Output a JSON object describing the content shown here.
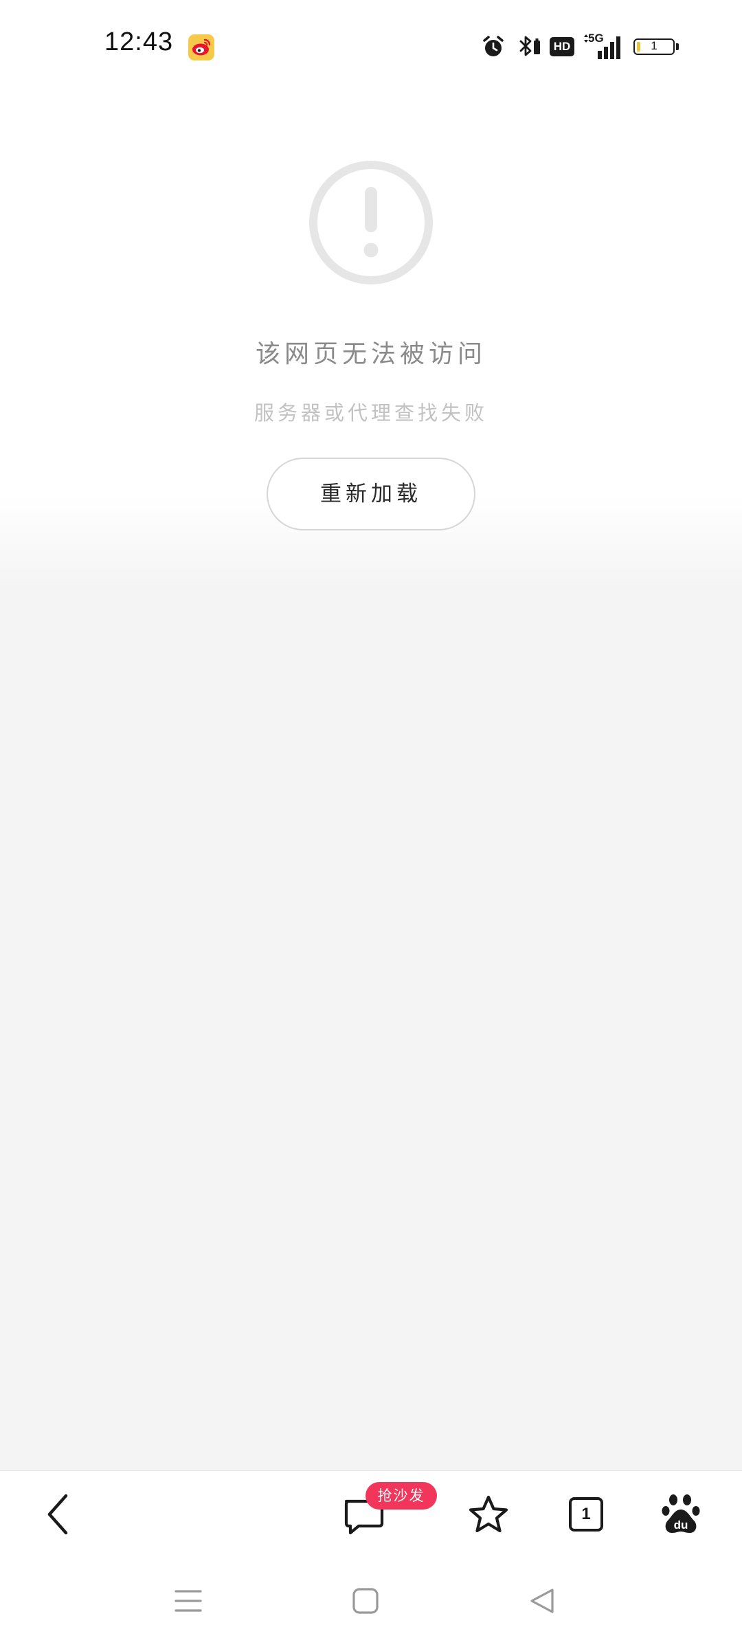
{
  "status_bar": {
    "time": "12:43",
    "notification_icons": [
      "weibo-icon"
    ],
    "system_icons": [
      "alarm-icon",
      "bluetooth-icon",
      "hd-icon",
      "signal-5g-icon",
      "battery-icon"
    ],
    "hd_label": "HD",
    "network_label": "5G",
    "battery_level": "1"
  },
  "error_page": {
    "icon": "exclamation-circle-icon",
    "title": "该网页无法被访问",
    "subtitle": "服务器或代理查找失败",
    "reload_label": "重新加载"
  },
  "toolbar": {
    "back_icon": "chevron-left-icon",
    "comment_icon": "comment-icon",
    "comment_badge": "抢沙发",
    "favorite_icon": "star-icon",
    "tab_count": "1",
    "baidu_icon": "baidu-paw-icon",
    "accent_color": "#f2355a"
  },
  "system_nav": {
    "icons": [
      "menu-icon",
      "home-icon",
      "back-triangle-icon"
    ]
  }
}
